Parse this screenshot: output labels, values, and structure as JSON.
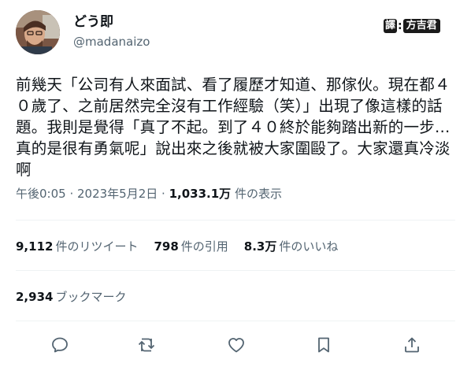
{
  "author": {
    "display_name": "どう即",
    "handle": "@madanaizo",
    "avatar_icon": "avatar-photo"
  },
  "translator_stamp": {
    "prefix": "譯",
    "separator": ":",
    "name": "方吉君"
  },
  "tweet": {
    "text": "前幾天「公司有人來面試、看了履歷才知道、那傢伙。現在都４\n０歲了、之前居然完全沒有工作經驗（笑）」出現了像這樣的話\n題。我則是覺得「真了不起。到了４０終於能夠踏出新的一步…\n真的是很有勇氣呢」說出來之後就被大家圍毆了。大家還真冷淡\n啊"
  },
  "meta": {
    "time": "午後0:05",
    "sep1": " · ",
    "date": "2023年5月2日",
    "sep2": " · ",
    "views_count": "1,033.1万",
    "views_label": " 件の表示"
  },
  "stats": {
    "retweets_count": "9,112",
    "retweets_label": "件のリツイート",
    "quotes_count": "798",
    "quotes_label": "件の引用",
    "likes_count": "8.3万",
    "likes_label": "件のいいね",
    "bookmarks_count": "2,934",
    "bookmarks_label": "ブックマーク"
  },
  "actions": {
    "reply_icon": "reply-icon",
    "retweet_icon": "retweet-icon",
    "like_icon": "heart-icon",
    "bookmark_icon": "bookmark-icon",
    "share_icon": "share-icon"
  },
  "colors": {
    "text_primary": "#0f1419",
    "text_secondary": "#536471",
    "divider": "#eff3f4"
  }
}
